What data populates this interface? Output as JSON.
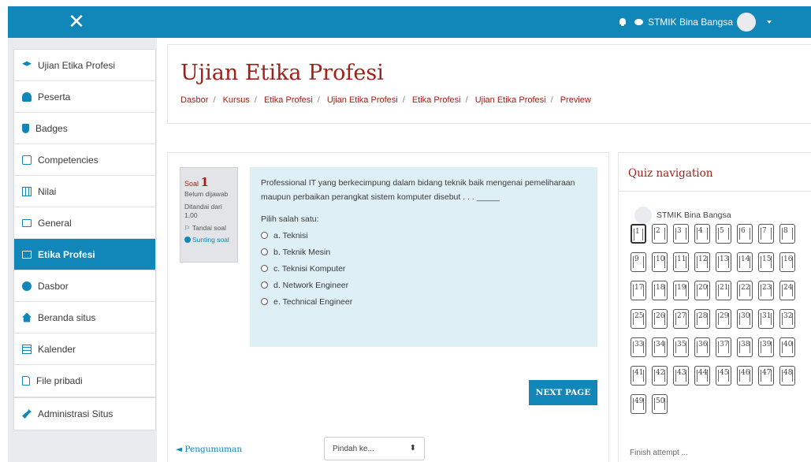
{
  "navbar": {
    "user_name": "STMIK Bina Bangsa"
  },
  "sidebar": {
    "items": [
      {
        "label": "Ujian Etika Profesi",
        "icon": "graduation-cap-icon"
      },
      {
        "label": "Peserta",
        "icon": "users-icon"
      },
      {
        "label": "Badges",
        "icon": "shield-icon"
      },
      {
        "label": "Competencies",
        "icon": "check-square-icon"
      },
      {
        "label": "Nilai",
        "icon": "table-icon"
      },
      {
        "label": "General",
        "icon": "folder-icon"
      },
      {
        "label": "Etika Profesi",
        "icon": "folder-icon",
        "active": true
      },
      {
        "label": "Dasbor",
        "icon": "dashboard-icon"
      },
      {
        "label": "Beranda situs",
        "icon": "home-icon"
      },
      {
        "label": "Kalender",
        "icon": "calendar-icon"
      },
      {
        "label": "File pribadi",
        "icon": "file-icon"
      },
      {
        "label": "Administrasi Situs",
        "icon": "wrench-icon"
      }
    ]
  },
  "header": {
    "title": "Ujian Etika Profesi",
    "breadcrumb": [
      "Dasbor",
      "Kursus",
      "Etika Profesi",
      "Ujian Etika Profesi",
      "Etika Profesi",
      "Ujian Etika Profesi",
      "Preview"
    ]
  },
  "question": {
    "label": "Soal",
    "number": "1",
    "status": "Belum dijawab",
    "marked_label": "Ditandai dari",
    "marked_value": "1,00",
    "flag_label": "Tandai soal",
    "edit_label": "Sunting soal",
    "text_line1": "Professional IT yang berkecimpung dalam bidang teknik baik mengenai pemeliharaan",
    "text_line2": "maupun perbaikan perangkat sistem komputer disebut . . . _____",
    "prompt": "Pilih salah satu:",
    "options": [
      "a. Teknisi",
      "b. Teknik Mesin",
      "c. Teknisi Komputer",
      "d. Network Engineer",
      "e. Technical Engineer"
    ]
  },
  "actions": {
    "next_label": "NEXT PAGE",
    "prev_label": "◄ Pengumuman",
    "jump_placeholder": "Pindah ke..."
  },
  "quiz_nav": {
    "title": "Quiz navigation",
    "user": "STMIK Bina Bangsa",
    "questions": [
      "1",
      "2",
      "3",
      "4",
      "5",
      "6",
      "7",
      "8",
      "9",
      "10",
      "11",
      "12",
      "13",
      "14",
      "15",
      "16",
      "17",
      "18",
      "19",
      "20",
      "21",
      "22",
      "23",
      "24",
      "25",
      "26",
      "27",
      "28",
      "29",
      "30",
      "31",
      "32",
      "33",
      "34",
      "35",
      "36",
      "37",
      "38",
      "39",
      "40",
      "41",
      "42",
      "43",
      "44",
      "45",
      "46",
      "47",
      "48",
      "49",
      "50"
    ],
    "current": "1",
    "finish_label": "Finish attempt ..."
  },
  "colors": {
    "primary": "#1186b8",
    "title_red": "#a02018",
    "question_bg": "#deeff6",
    "sidebar_bg": "#e9ebee"
  }
}
